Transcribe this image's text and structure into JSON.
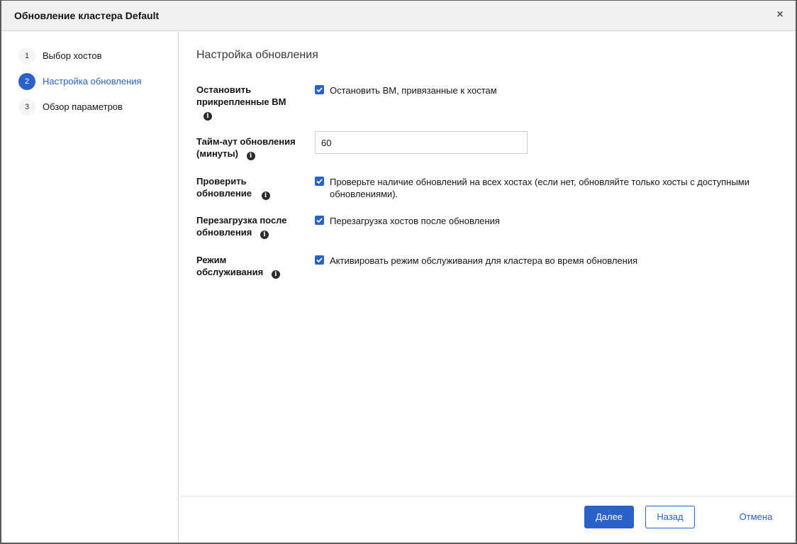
{
  "dialog": {
    "title": "Обновление кластера Default",
    "close_label": "×"
  },
  "sidebar": {
    "steps": [
      {
        "number": "1",
        "label": "Выбор хостов",
        "active": false
      },
      {
        "number": "2",
        "label": "Настройка обновления",
        "active": true
      },
      {
        "number": "3",
        "label": "Обзор параметров",
        "active": false
      }
    ]
  },
  "form": {
    "title": "Настройка обновления",
    "info_icon": "i",
    "stop_vms": {
      "label_line1": "Остановить",
      "label_line2": "прикрепленные ВМ",
      "checkbox_text": "Остановить ВМ, привязанные к хостам",
      "checked": true
    },
    "timeout": {
      "label_line1": "Тайм-аут обновления",
      "label_line2": "(минуты)",
      "value": "60"
    },
    "check_upgrade": {
      "label_line1": "Проверить",
      "label_line2": "обновление",
      "checkbox_text_line1": "Проверьте наличие обновлений на всех хостах (если нет, обновляйте только хосты с доступными",
      "checkbox_text_line2": "обновлениями).",
      "checked": true
    },
    "reboot": {
      "label_line1": "Перезагрузка после",
      "label_line2": "обновления",
      "checkbox_text": "Перезагрузка хостов после обновления",
      "checked": true
    },
    "maintenance": {
      "label_line1": "Режим",
      "label_line2": "обслуживания",
      "checkbox_text": "Активировать режим обслуживания для кластера во время обновления",
      "checked": true
    }
  },
  "footer": {
    "next_label": "Далее",
    "back_label": "Назад",
    "cancel_label": "Отмена"
  },
  "colors": {
    "accent": "#2b62c9",
    "header_bg": "#f0f0f0"
  }
}
